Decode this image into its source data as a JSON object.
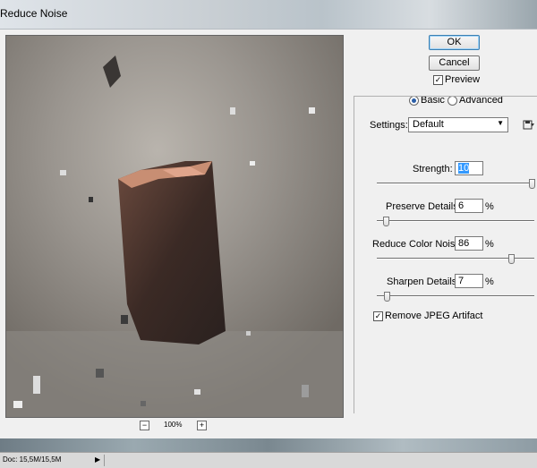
{
  "window": {
    "title": "Reduce Noise"
  },
  "preview": {
    "zoom_minus": "−",
    "zoom_plus": "+",
    "zoom_level": "100%"
  },
  "buttons": {
    "ok": "OK",
    "cancel": "Cancel"
  },
  "preview_checkbox": {
    "label": "Preview",
    "checked": true,
    "mark": "✓"
  },
  "mode": {
    "basic": "Basic",
    "advanced": "Advanced",
    "selected": "basic"
  },
  "settings": {
    "label": "Settings:",
    "value": "Default",
    "dropdown_arrow": "▼",
    "save_icon": "save-settings-icon"
  },
  "params": {
    "strength": {
      "label": "Strength:",
      "value": "10",
      "fraction": 1.0
    },
    "preserve": {
      "label": "Preserve Details:",
      "value": "6",
      "unit": "%",
      "fraction": 0.06
    },
    "color_noise": {
      "label": "Reduce Color Noise:",
      "value": "86",
      "unit": "%",
      "fraction": 0.86
    },
    "sharpen": {
      "label": "Sharpen Details:",
      "value": "7",
      "unit": "%",
      "fraction": 0.07
    }
  },
  "jpeg": {
    "label": "Remove JPEG Artifact",
    "checked": true,
    "mark": "✓"
  },
  "status": {
    "doc": "Doc: 15,5M/15,5M",
    "arrow": "▶"
  }
}
